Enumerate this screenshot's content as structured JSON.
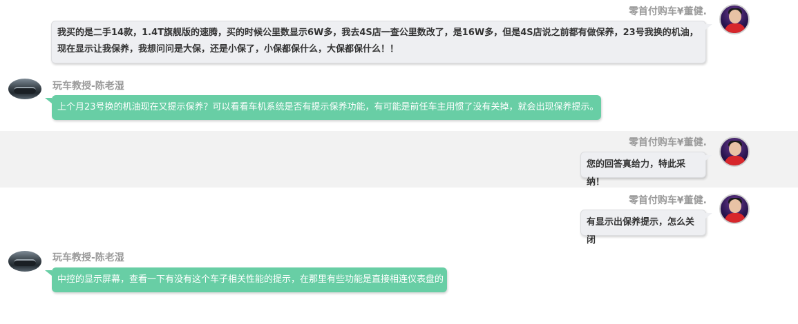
{
  "messages": [
    {
      "side": "right",
      "sender": "零首付购车¥董健.",
      "text": "我买的是二手14款，1.4T旗舰版的速腾，买的时候公里数显示6W多，我去4S店一查公里数改了，是16W多，但是4S店说之前都有做保养，23号我换的机油，现在显示让我保养，我想问问是大保，还是小保了，小保都保什么，大保都保什么！！"
    },
    {
      "side": "left",
      "sender": "玩车教授-陈老湿",
      "text": "上个月23号换的机油现在又提示保养？可以看看车机系统是否有提示保养功能，有可能是前任车主用惯了没有关掉，就会出现保养提示。"
    },
    {
      "side": "right",
      "sender": "零首付购车¥董健.",
      "text": "您的回答真给力，特此采纳！",
      "highlighted": true
    },
    {
      "side": "right",
      "sender": "零首付购车¥董健.",
      "text": "有显示出保养提示，怎么关闭"
    },
    {
      "side": "left",
      "sender": "玩车教授-陈老湿",
      "text": "中控的显示屏幕，查看一下有没有这个车子相关性能的提示，在那里有些功能是直接相连仪表盘的"
    }
  ],
  "colors": {
    "user_bubble": "#eeeff2",
    "expert_bubble": "#68cea5",
    "highlight_row": "#f2f2f2",
    "name_text": "#9a9a9a"
  },
  "icons": {
    "user_avatar": "user-avatar-icon",
    "expert_avatar": "expert-avatar-icon"
  }
}
